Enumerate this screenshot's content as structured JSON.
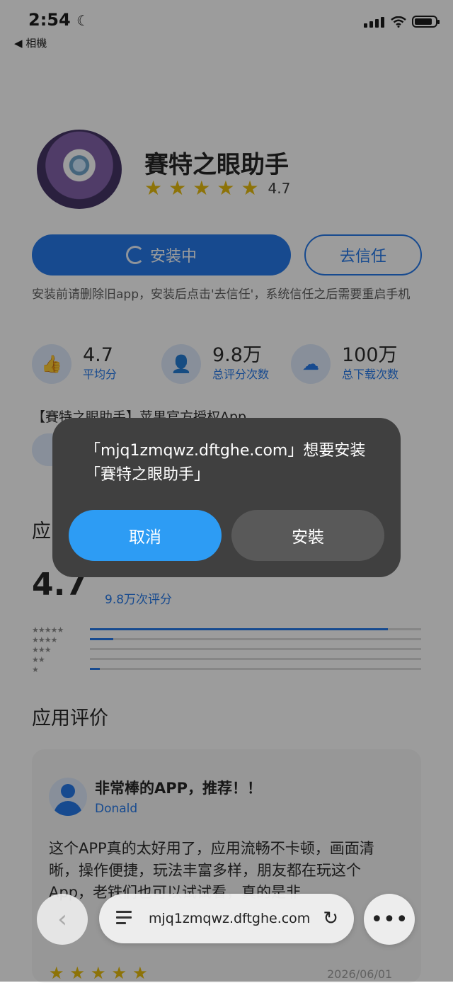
{
  "status_bar": {
    "time": "2:54",
    "moon_icon": "moon-icon",
    "back_label": "◀ 相機"
  },
  "app": {
    "name": "賽特之眼助手",
    "rating": "4.7",
    "install_button": "安装中",
    "trust_button": "去信任",
    "notice": "安装前请删除旧app，安装后点击'去信任'，系统信任之后需要重启手机",
    "description": "【賽特之眼助手】苹果官方授权App"
  },
  "stats": [
    {
      "value": "4.7",
      "label": "平均分",
      "icon": "thumbs-up-icon"
    },
    {
      "value": "9.8万",
      "label": "总评分次数",
      "icon": "user-icon"
    },
    {
      "value": "100万",
      "label": "总下载次数",
      "icon": "cloud-download-icon"
    }
  ],
  "ratings_section": {
    "title_partial": "应",
    "big_rating": "4.7",
    "count_label": "9.8万次评分",
    "distribution": [
      {
        "stars": "★★★★★",
        "fraction": 0.9
      },
      {
        "stars": "★★★★",
        "fraction": 0.07
      },
      {
        "stars": "★★★",
        "fraction": 0.0
      },
      {
        "stars": "★★",
        "fraction": 0.0
      },
      {
        "stars": "★",
        "fraction": 0.03
      }
    ]
  },
  "reviews_section": {
    "title": "应用评价",
    "review": {
      "title": "非常棒的APP，推荐！！",
      "user": "Donald",
      "text": "这个APP真的太好用了，应用流畅不卡顿，画面清晰，操作便捷，玩法丰富多样，朋友都在玩这个App，老铁们也可以试试看，真的是非",
      "stars": "★★★★★",
      "date": "2026/06/01"
    }
  },
  "dialog": {
    "message": "「mjq1zmqwz.dftghe.com」想要安装「賽特之眼助手」",
    "cancel_label": "取消",
    "install_label": "安裝"
  },
  "browser_bar": {
    "url": "mjq1zmqwz.dftghe.com",
    "back_icon": "chevron-left-icon",
    "reload_icon": "reload-icon",
    "more_icon": "more-icon"
  },
  "colors": {
    "accent": "#1a73e8",
    "star": "#e6b800",
    "dialog_bg": "#404040",
    "cancel_bg": "#2d9cf4"
  }
}
